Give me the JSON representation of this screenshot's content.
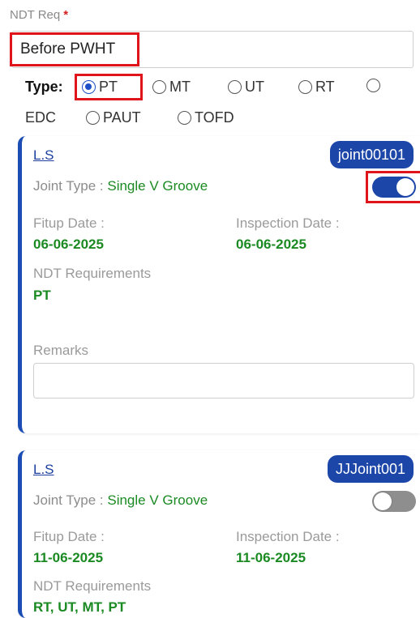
{
  "ndt": {
    "label": "NDT Req",
    "required_mark": "*",
    "value": "Before PWHT"
  },
  "type_filter": {
    "label": "Type:",
    "options": [
      "PT",
      "MT",
      "UT",
      "RT",
      "EDC",
      "PAUT",
      "TOFD"
    ],
    "selected": "PT"
  },
  "cards": [
    {
      "link": "L.S",
      "joint_id": "joint00101",
      "joint_type_label": "Joint Type : ",
      "joint_type": "Single V Groove",
      "toggle_on": true,
      "fitup_label": "Fitup Date :",
      "fitup_date": "06-06-2025",
      "inspection_label": "Inspection Date :",
      "inspection_date": "06-06-2025",
      "ndt_req_label": "NDT Requirements",
      "ndt_req": "PT",
      "remarks_label": "Remarks",
      "remarks_value": ""
    },
    {
      "link": "L.S",
      "joint_id": "JJJoint001",
      "joint_type_label": "Joint Type : ",
      "joint_type": "Single V Groove",
      "toggle_on": false,
      "fitup_label": "Fitup Date :",
      "fitup_date": "11-06-2025",
      "inspection_label": "Inspection Date :",
      "inspection_date": "11-06-2025",
      "ndt_req_label": "NDT Requirements",
      "ndt_req": "RT, UT, MT, PT"
    }
  ],
  "colors": {
    "accent": "#1c46a8",
    "highlight": "#e0141b",
    "value_green": "#1b8a22"
  }
}
